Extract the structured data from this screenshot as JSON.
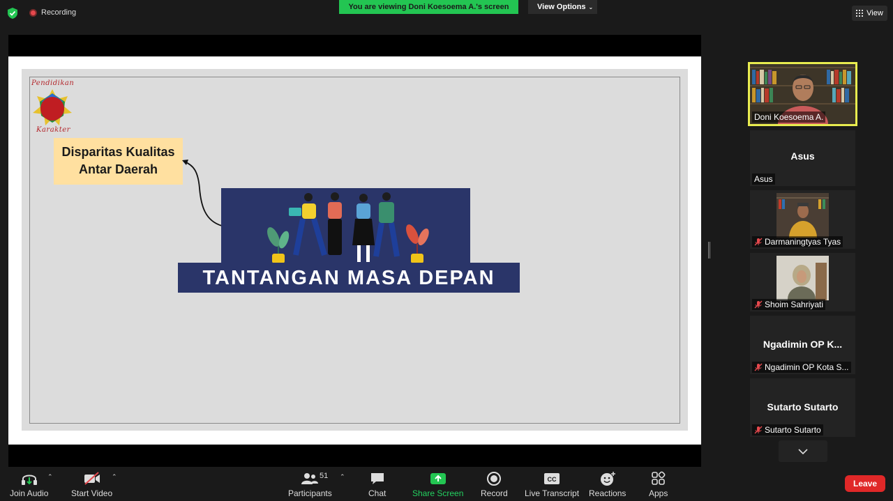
{
  "topbar": {
    "recording_label": "Recording",
    "viewing_banner": "You are viewing Doni Koesoema A.'s screen",
    "view_options_label": "View Options",
    "view_label": "View"
  },
  "slide": {
    "logo_top_text": "Pendidikan",
    "logo_bottom_text": "Karakter",
    "callout_line1": "Disparitas Kualitas",
    "callout_line2": "Antar Daerah",
    "banner_title": "TANTANGAN MASA DEPAN"
  },
  "participants_panel": {
    "tiles": [
      {
        "label": "Doni Koesoema A.",
        "muted": false,
        "active": true
      },
      {
        "display": "Asus",
        "label": "Asus",
        "muted": false
      },
      {
        "label": "Darmaningtyas Tyas",
        "muted": true
      },
      {
        "label": "Shoim Sahriyati",
        "muted": true
      },
      {
        "display": "Ngadimin OP K...",
        "label": "Ngadimin OP Kota S...",
        "muted": true
      },
      {
        "display": "Sutarto Sutarto",
        "label": "Sutarto Sutarto",
        "muted": true
      }
    ]
  },
  "toolbar": {
    "join_audio": "Join Audio",
    "start_video": "Start Video",
    "participants": "Participants",
    "participants_count": "51",
    "chat": "Chat",
    "share_screen": "Share Screen",
    "record": "Record",
    "live_transcript": "Live Transcript",
    "reactions": "Reactions",
    "apps": "Apps",
    "leave": "Leave"
  },
  "colors": {
    "banner_green": "#23c552",
    "active_speaker_border": "#e8ec4f",
    "slide_banner_navy": "#2a3569",
    "callout_bg": "#ffe0a0",
    "leave_red": "#e02828"
  }
}
